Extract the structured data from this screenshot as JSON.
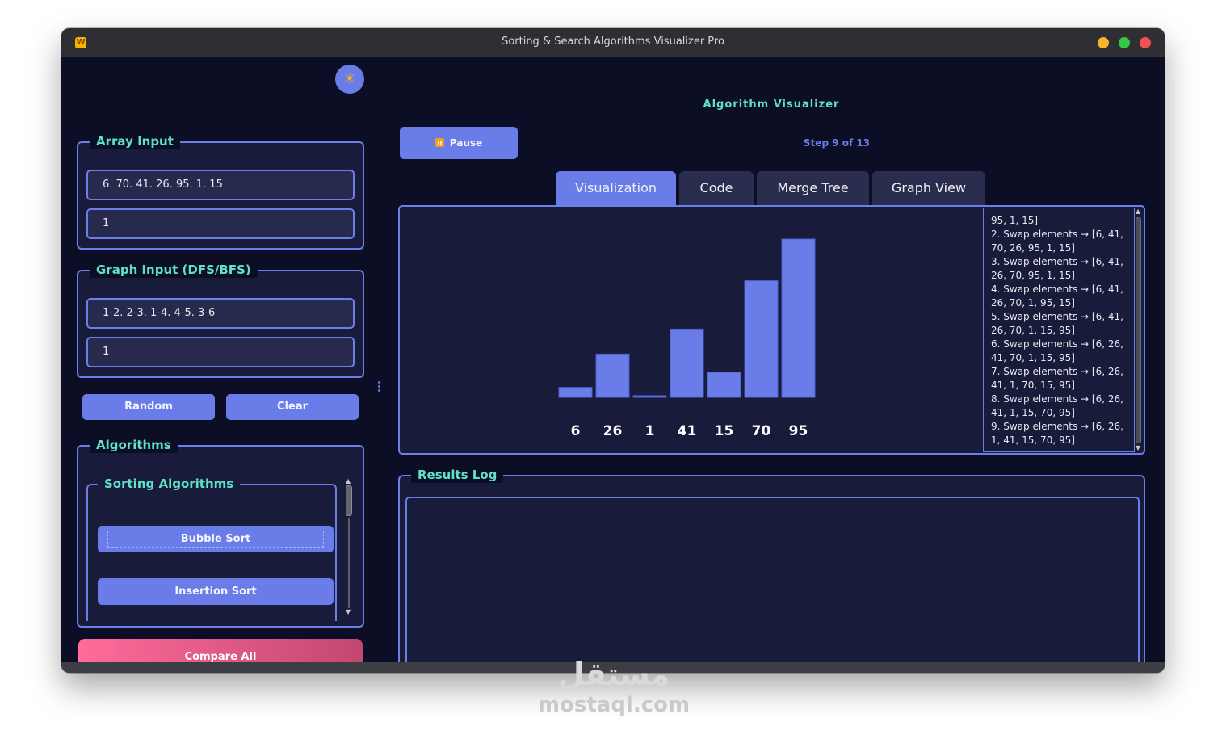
{
  "window": {
    "title": "Sorting & Search Algorithms Visualizer Pro",
    "app_icon": "W"
  },
  "theme_toggle": {
    "icon": "sun-icon",
    "glyph": "☀"
  },
  "array_input": {
    "legend": "Array Input",
    "values_field": "6. 70. 41. 26. 95. 1. 15",
    "target_field": "1"
  },
  "graph_input": {
    "legend": "Graph Input (DFS/BFS)",
    "edges_field": "1-2. 2-3. 1-4. 4-5. 3-6",
    "start_field": "1"
  },
  "buttons": {
    "random": "Random",
    "clear": "Clear",
    "compare_all": "Compare All"
  },
  "algorithms": {
    "legend": "Algorithms",
    "sorting_legend": "Sorting Algorithms",
    "items": [
      "Bubble Sort",
      "Insertion Sort"
    ]
  },
  "header": {
    "title": "Algorithm Visualizer"
  },
  "controls": {
    "pause_label": "Pause",
    "step_label": "Step 9 of 13"
  },
  "tabs": [
    "Visualization",
    "Code",
    "Merge Tree",
    "Graph View"
  ],
  "active_tab": "Visualization",
  "step_log": [
    "95, 1, 15]",
    "2. Swap elements → [6, 41, 70, 26, 95, 1, 15]",
    "3. Swap elements → [6, 41, 26, 70, 95, 1, 15]",
    "4. Swap elements → [6, 41, 26, 70, 1, 95, 15]",
    "5. Swap elements → [6, 41, 26, 70, 1, 15, 95]",
    "6. Swap elements → [6, 26, 41, 70, 1, 15, 95]",
    "7. Swap elements → [6, 26, 41, 1, 70, 15, 95]",
    "8. Swap elements → [6, 26, 41, 1, 15, 70, 95]",
    "9. Swap elements → [6, 26, 1, 41, 15, 70, 95]"
  ],
  "results": {
    "legend": "Results Log"
  },
  "colors": {
    "background": "#0b0e24",
    "panel": "#191b3a",
    "accent": "#6a7ce8",
    "heading": "#5fe0c8",
    "compare_gradient_start": "#ff6b9a",
    "compare_gradient_end": "#c24870"
  },
  "chart_data": {
    "type": "bar",
    "categories": [
      "6",
      "26",
      "1",
      "41",
      "15",
      "70",
      "95"
    ],
    "values": [
      6,
      26,
      1,
      41,
      15,
      70,
      95
    ],
    "ylim": [
      0,
      95
    ]
  },
  "watermark": {
    "arabic": "مستقل",
    "latin": "mostaql.com"
  }
}
